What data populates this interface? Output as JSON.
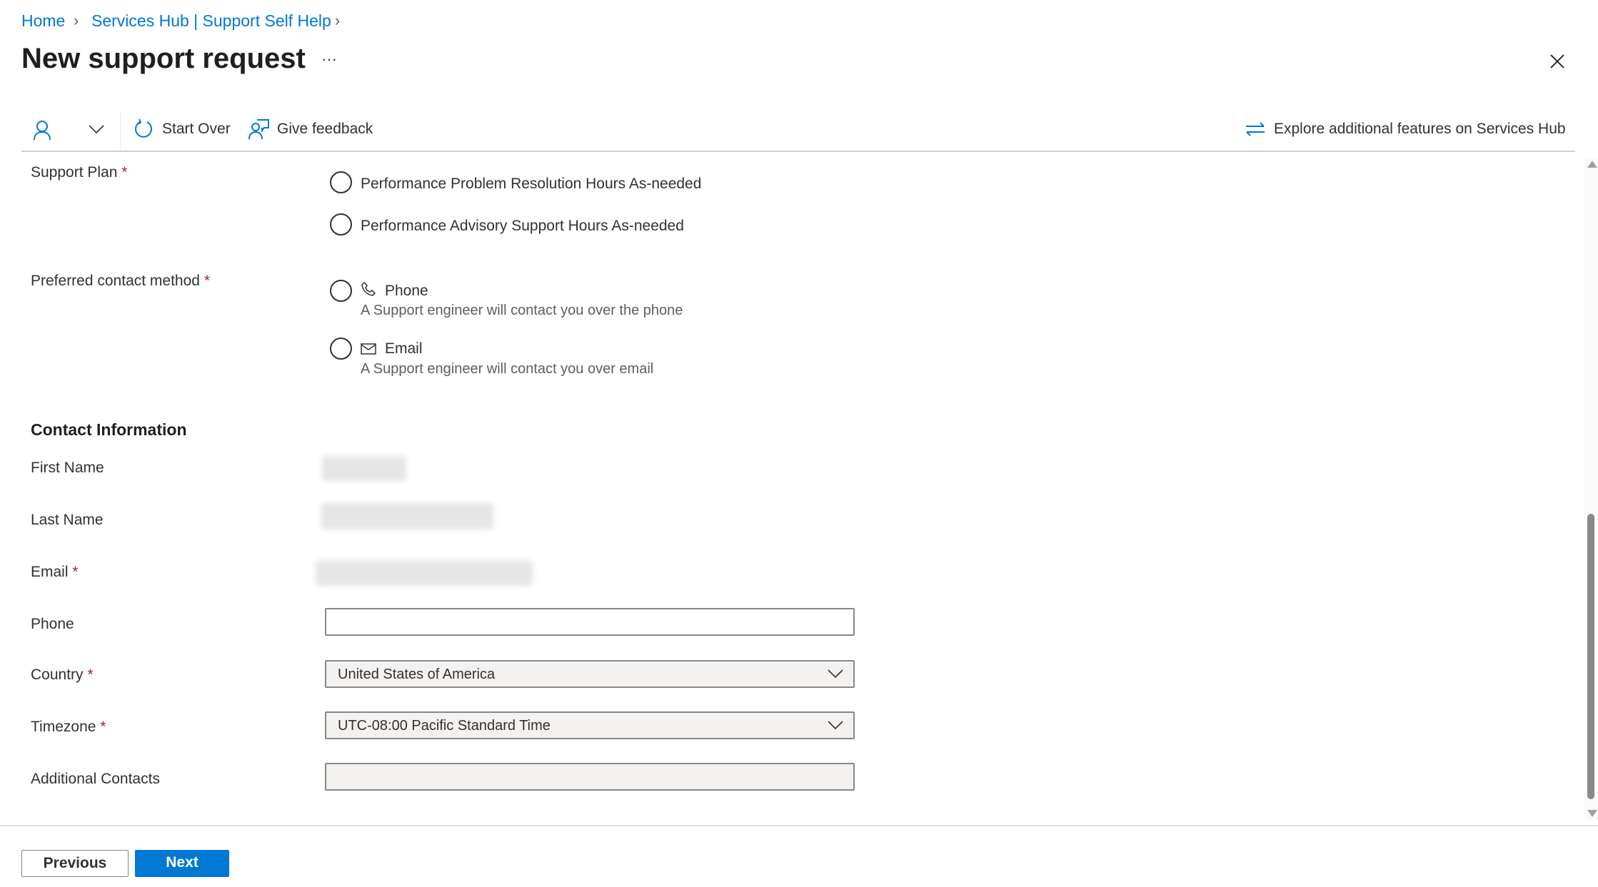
{
  "breadcrumb": [
    {
      "label": "Home"
    },
    {
      "label": "Services Hub | Support Self Help"
    }
  ],
  "header": {
    "title": "New support request",
    "more_label": "···"
  },
  "toolbar": {
    "start_over": "Start Over",
    "give_feedback": "Give feedback",
    "explore": "Explore additional features on Services Hub"
  },
  "form": {
    "support_plan": {
      "label": "Support Plan",
      "required": "*",
      "options": [
        "Performance Problem Resolution Hours As-needed",
        "Performance Advisory Support Hours As-needed"
      ]
    },
    "contact_method": {
      "label": "Preferred contact method",
      "required": "*",
      "options": [
        {
          "label": "Phone",
          "icon": "phone-icon",
          "description": "A Support engineer will contact you over the phone"
        },
        {
          "label": "Email",
          "icon": "mail-icon",
          "description": "A Support engineer will contact you over email"
        }
      ]
    },
    "contact_info": {
      "heading": "Contact Information",
      "first_name": {
        "label": "First Name"
      },
      "last_name": {
        "label": "Last Name"
      },
      "email": {
        "label": "Email",
        "required": "*"
      },
      "phone": {
        "label": "Phone",
        "value": ""
      },
      "country": {
        "label": "Country",
        "required": "*",
        "value": "United States of America"
      },
      "timezone": {
        "label": "Timezone",
        "required": "*",
        "value": "UTC-08:00 Pacific Standard Time"
      },
      "additional_contacts": {
        "label": "Additional Contacts",
        "value": ""
      }
    }
  },
  "footer": {
    "previous": "Previous",
    "next": "Next"
  },
  "colors": {
    "accent": "#0078d4",
    "required": "#a4262c",
    "text": "#323130"
  }
}
